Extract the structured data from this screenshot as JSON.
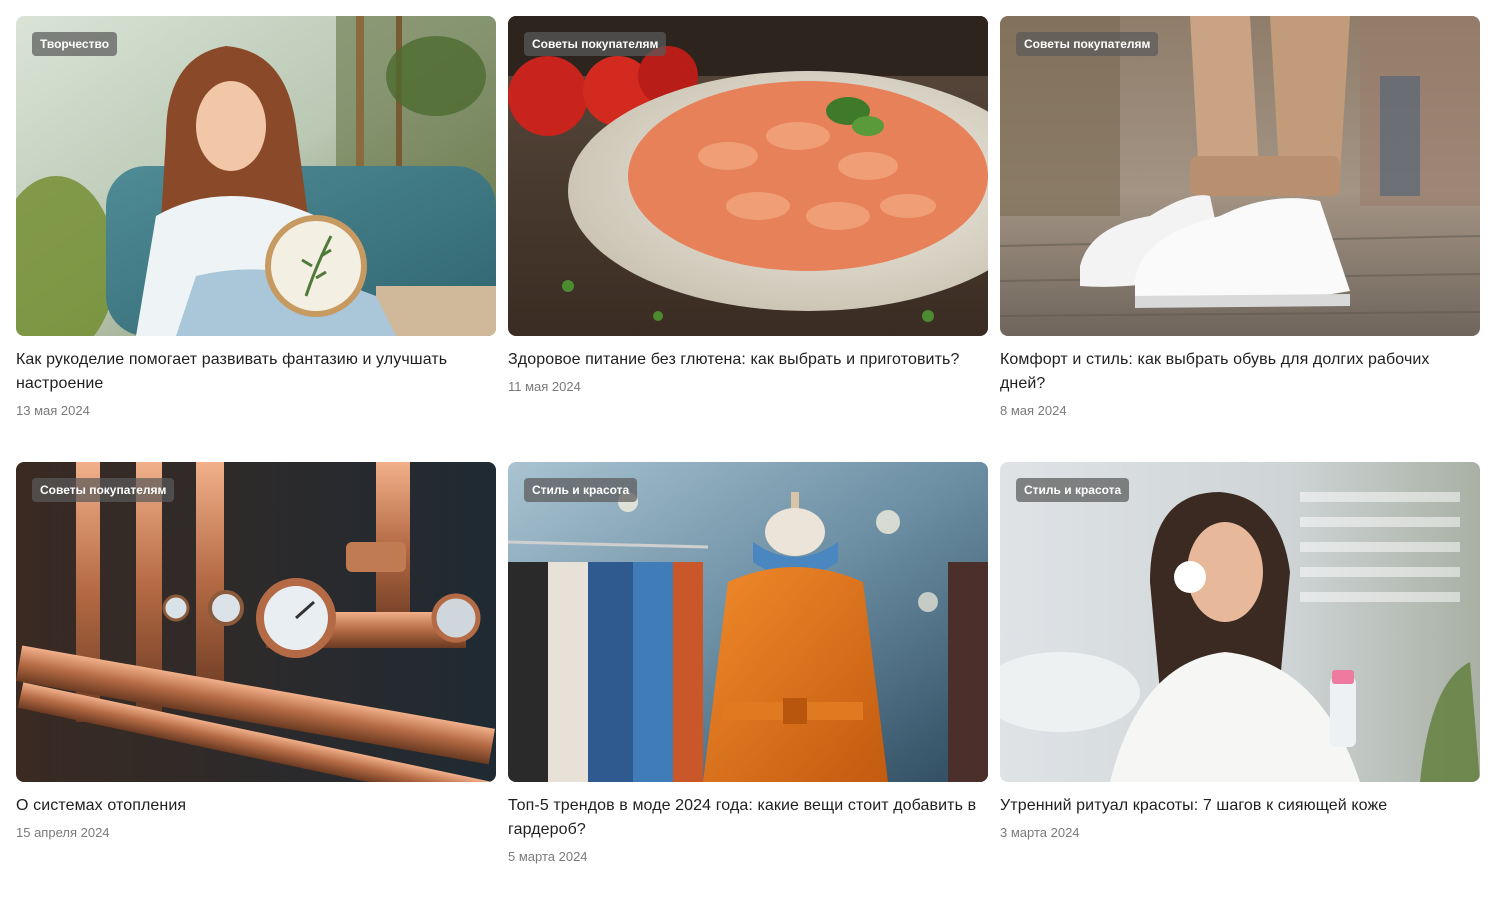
{
  "articles": [
    {
      "tag": "Творчество",
      "title": "Как рукоделие помогает развивать фантазию и улучшать настроение",
      "date": "13 мая 2024",
      "image": "woman-embroidery-photo"
    },
    {
      "tag": "Советы покупателям",
      "title": "Здоровое питание без глютена: как выбрать и приготовить?",
      "date": "11 мая 2024",
      "image": "pasta-plate-photo"
    },
    {
      "tag": "Советы покупателям",
      "title": "Комфорт и стиль: как выбрать обувь для долгих рабочих дней?",
      "date": "8 мая 2024",
      "image": "white-sneakers-photo"
    },
    {
      "tag": "Советы покупателям",
      "title": "О системах отопления",
      "date": "15 апреля 2024",
      "image": "heating-pipes-photo"
    },
    {
      "tag": "Стиль и красота",
      "title": "Топ-5 трендов в моде 2024 года: какие вещи стоит добавить в гардероб?",
      "date": "5 марта 2024",
      "image": "orange-coat-mannequin-photo"
    },
    {
      "tag": "Стиль и красота",
      "title": "Утренний ритуал красоты: 7 шагов к сияющей коже",
      "date": "3 марта 2024",
      "image": "woman-skincare-photo"
    }
  ],
  "colors": {
    "tag_background": "#5a5a5a",
    "title_text": "#1f1f1f",
    "date_text": "#7a7a7a"
  }
}
